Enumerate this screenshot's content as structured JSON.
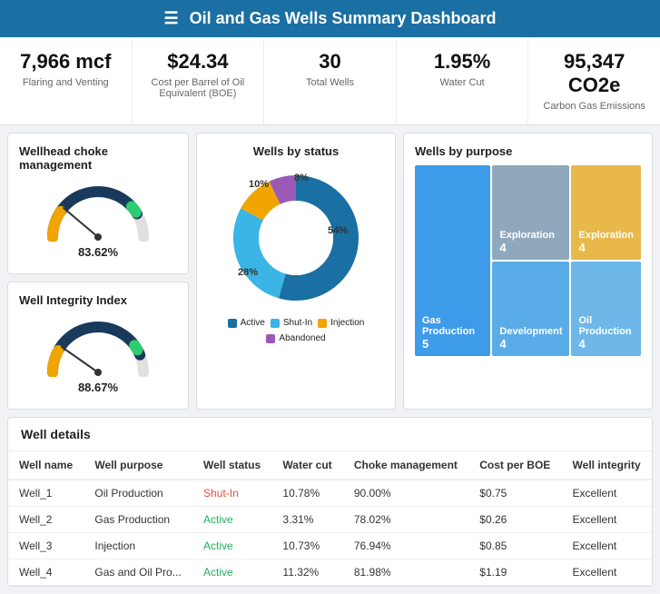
{
  "header": {
    "title": "Oil and Gas Wells Summary Dashboard",
    "menu_icon": "☰"
  },
  "kpis": [
    {
      "value": "7,966 mcf",
      "label": "Flaring and Venting"
    },
    {
      "value": "$24.34",
      "label": "Cost per Barrel of Oil Equivalent (BOE)"
    },
    {
      "value": "30",
      "label": "Total Wells"
    },
    {
      "value": "1.95%",
      "label": "Water Cut"
    },
    {
      "value": "95,347 CO2e",
      "label": "Carbon Gas Emissions"
    }
  ],
  "wellhead_choke": {
    "title": "Wellhead choke management",
    "value": "83.62%",
    "percent": 83.62
  },
  "well_integrity": {
    "title": "Well Integrity Index",
    "value": "88.67%",
    "percent": 88.67
  },
  "wells_by_status": {
    "title": "Wells by status",
    "segments": [
      {
        "label": "Active",
        "percent": 54,
        "color": "#1a6fa3"
      },
      {
        "label": "Shut-In",
        "percent": 28,
        "color": "#3ab5e5"
      },
      {
        "label": "Injection",
        "percent": 10,
        "color": "#f0a500"
      },
      {
        "label": "Abandoned",
        "percent": 8,
        "color": "#9b59b6"
      }
    ],
    "labels": [
      "54%",
      "28%",
      "10%",
      "8%"
    ]
  },
  "wells_by_purpose": {
    "title": "Wells by purpose",
    "cells": [
      {
        "label": "Gas Production",
        "value": "5",
        "color": "#3d9be9",
        "span": "row2"
      },
      {
        "label": "Exploration",
        "value": "4",
        "color": "#95a5b5"
      },
      {
        "label": "Exploration",
        "value": "4",
        "color": "#e8b84b"
      },
      {
        "label": "Development",
        "value": "4",
        "color": "#5aace8"
      },
      {
        "label": "Oil Production",
        "value": "4",
        "color": "#6db8e8"
      }
    ]
  },
  "well_details": {
    "title": "Well details",
    "columns": [
      "Well name",
      "Well purpose",
      "Well status",
      "Water cut",
      "Choke management",
      "Cost per BOE",
      "Well integrity"
    ],
    "rows": [
      {
        "name": "Well_1",
        "purpose": "Oil Production",
        "status": "Shut-In",
        "status_type": "shutin",
        "water_cut": "10.78%",
        "choke": "90.00%",
        "cost": "$0.75",
        "integrity": "Excellent"
      },
      {
        "name": "Well_2",
        "purpose": "Gas Production",
        "status": "Active",
        "status_type": "active",
        "water_cut": "3.31%",
        "choke": "78.02%",
        "cost": "$0.26",
        "integrity": "Excellent"
      },
      {
        "name": "Well_3",
        "purpose": "Injection",
        "status": "Active",
        "status_type": "active",
        "water_cut": "10.73%",
        "choke": "76.94%",
        "cost": "$0.85",
        "integrity": "Excellent"
      },
      {
        "name": "Well_4",
        "purpose": "Gas and Oil Pro...",
        "status": "Active",
        "status_type": "active",
        "water_cut": "11.32%",
        "choke": "81.98%",
        "cost": "$1.19",
        "integrity": "Excellent"
      }
    ]
  }
}
